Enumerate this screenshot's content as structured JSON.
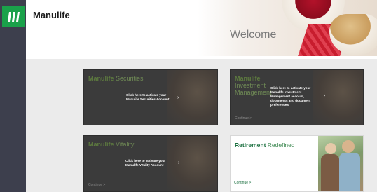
{
  "brand": {
    "name": "Manulife"
  },
  "hero": {
    "welcome": "Welcome"
  },
  "tiles": [
    {
      "title_strong": "Manulife",
      "title_light": "Securities",
      "message": "Click here to activate your Manulife Securities Account",
      "continue": ""
    },
    {
      "title_strong": "Manulife",
      "title_light": "Investment Management",
      "message": "Click here to activate your Manulife Investment Management account, documents and document preferences",
      "continue": "Continue >"
    },
    {
      "title_strong": "Manulife",
      "title_light": "Vitality",
      "message": "Click here to activate your Manulife Vitality Account",
      "continue": "Continue >"
    },
    {
      "title_strong": "Retirement",
      "title_light": "Redefined",
      "message": "",
      "continue": "Continue >"
    }
  ],
  "icons": {
    "logo": "manulife-logo-icon",
    "chevron": "chevron-right-icon"
  },
  "colors": {
    "sidebar": "#3d3f4d",
    "logo_green": "#1aa14a",
    "tile_dark": "#3b3b3b",
    "retirement_green": "#1a6f3f"
  }
}
